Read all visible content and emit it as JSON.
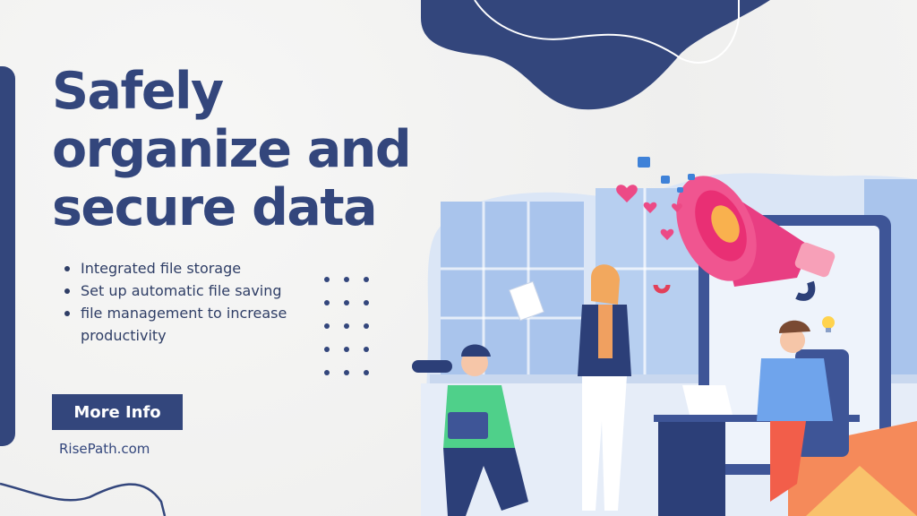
{
  "headline": {
    "lines": [
      "Safely",
      "organize and",
      "secure data"
    ]
  },
  "features": [
    "Integrated file storage",
    "Set up automatic file saving",
    "file management to increase productivity"
  ],
  "cta": {
    "label": "More Info"
  },
  "website": "RisePath.com",
  "colors": {
    "brand_navy": "#33467c",
    "background": "#f2f2f1",
    "megaphone_pink": "#ec4a86",
    "accent_orange": "#f58a5a",
    "sky_blue": "#8fb3e6"
  },
  "illustration": {
    "description": "Three people in an office: man with binoculars and tablet, woman holding document and magnet, man at desk with laptop; large pink megaphone emitting hearts and thumbs-up icons; phone frame, lightbulb, envelope",
    "icons": [
      "megaphone-icon",
      "heart-icon",
      "thumbs-up-icon",
      "lightbulb-icon",
      "binoculars-icon",
      "magnet-icon",
      "laptop-icon",
      "envelope-icon"
    ]
  }
}
